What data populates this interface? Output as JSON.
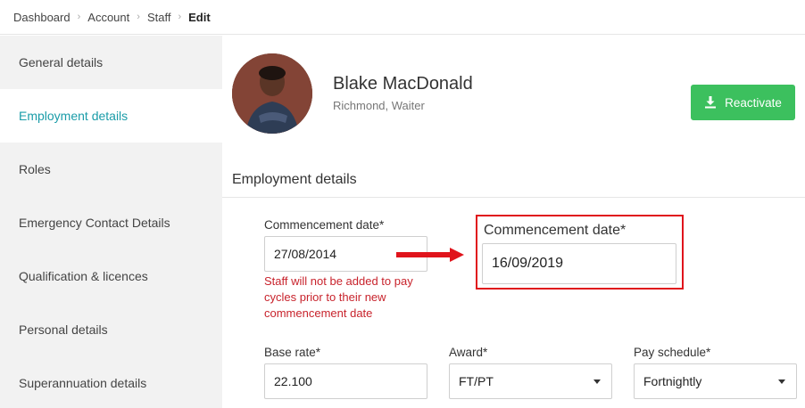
{
  "breadcrumb": {
    "items": [
      "Dashboard",
      "Account",
      "Staff"
    ],
    "current": "Edit"
  },
  "sidebar": {
    "items": [
      {
        "label": "General details"
      },
      {
        "label": "Employment details",
        "active": true
      },
      {
        "label": "Roles"
      },
      {
        "label": "Emergency Contact Details"
      },
      {
        "label": "Qualification & licences"
      },
      {
        "label": "Personal details"
      },
      {
        "label": "Superannuation details"
      }
    ]
  },
  "profile": {
    "name": "Blake MacDonald",
    "subtitle": "Richmond, Waiter"
  },
  "actions": {
    "reactivate_label": "Reactivate",
    "reactivate_icon": "download-icon"
  },
  "employment": {
    "section_title": "Employment details",
    "commencement": {
      "label": "Commencement date*",
      "value": "27/08/2014",
      "warning": "Staff will not be added to pay cycles prior to their new commencement date"
    },
    "commencement_new": {
      "label": "Commencement date*",
      "value": "16/09/2019"
    },
    "base_rate": {
      "label": "Base rate*",
      "value": "22.100"
    },
    "award": {
      "label": "Award*",
      "value": "FT/PT"
    },
    "pay_schedule": {
      "label": "Pay schedule*",
      "value": "Fortnightly"
    }
  },
  "colors": {
    "accent": "#1a9ca8",
    "success": "#3cc05e",
    "warning": "#c8232c",
    "highlight": "#e0141c"
  }
}
